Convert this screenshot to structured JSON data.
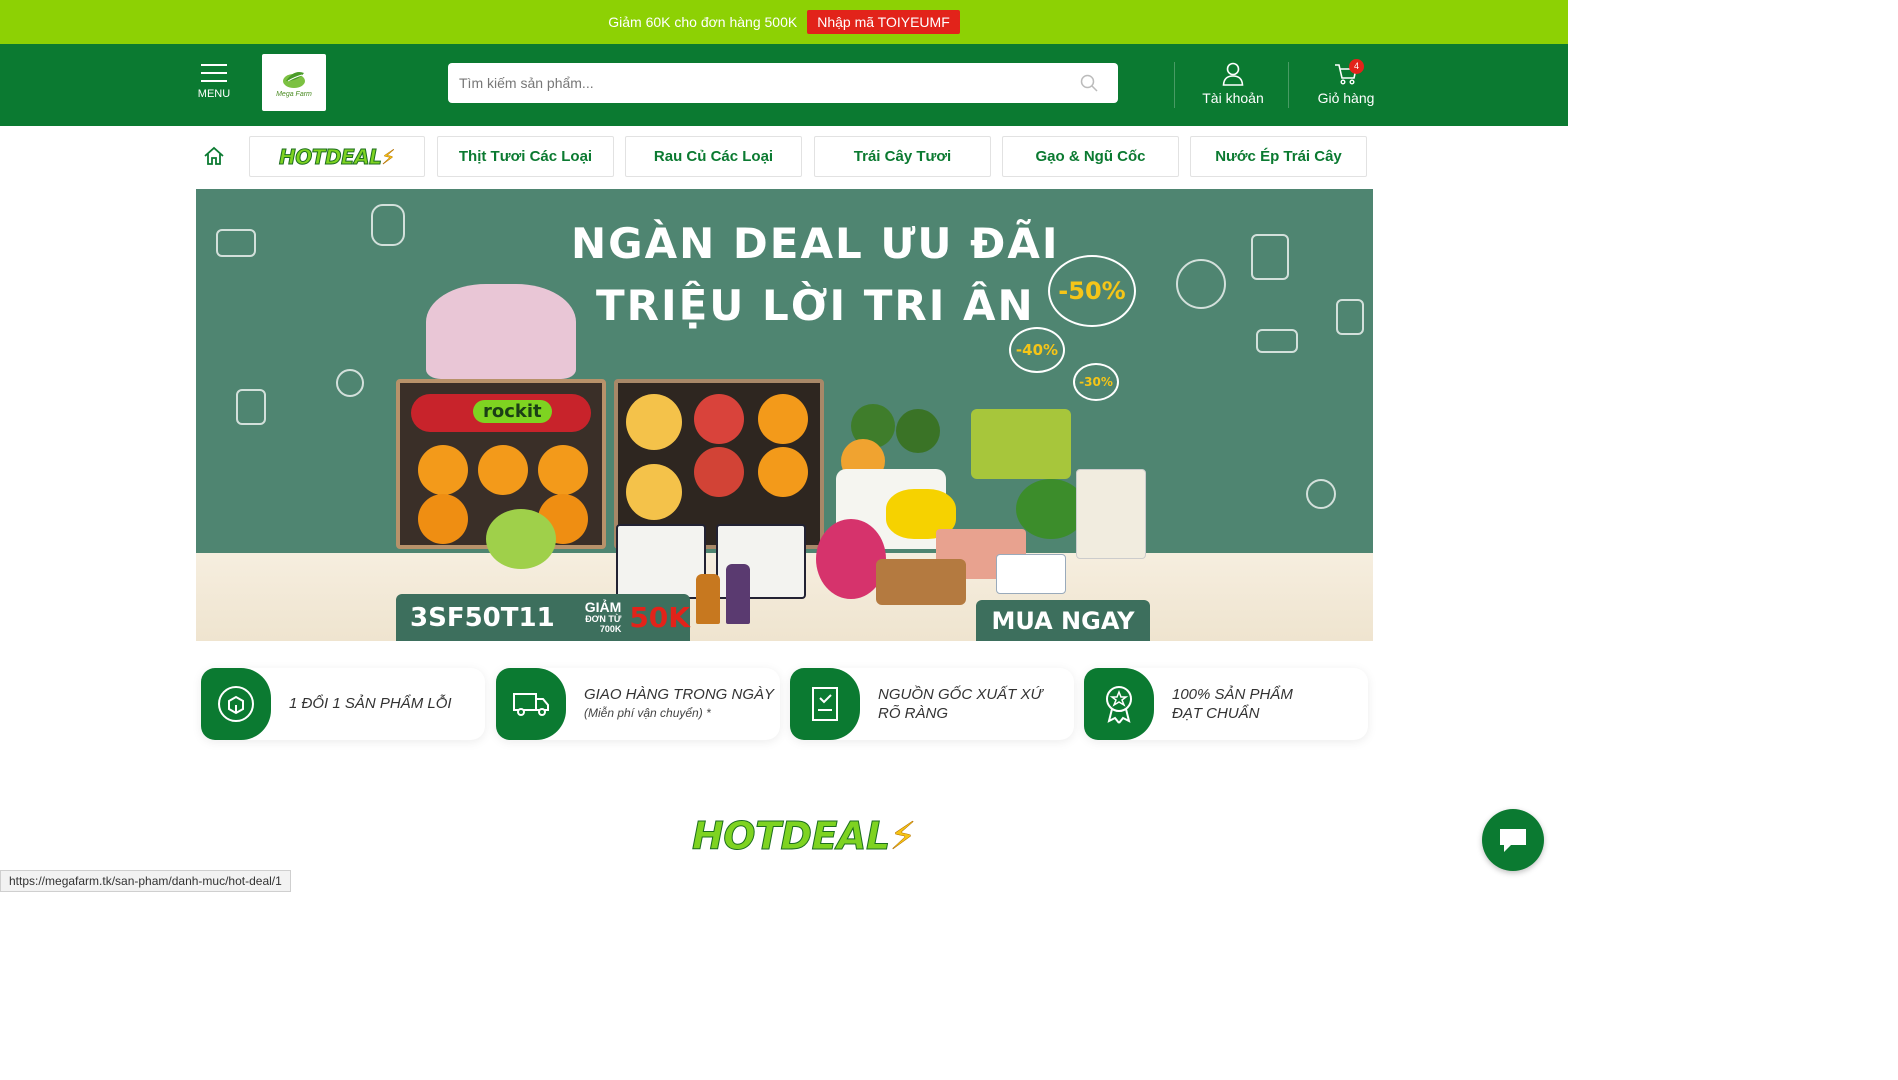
{
  "promo": {
    "text": "Giảm 60K cho đơn hàng 500K",
    "code": "Nhập mã TOIYEUMF"
  },
  "header": {
    "menu_label": "MENU",
    "logo_text": "Mega Farm",
    "search_placeholder": "Tìm kiếm sản phẩm...",
    "account_label": "Tài khoản",
    "cart_label": "Giỏ hàng",
    "cart_count": "4"
  },
  "nav": {
    "hotdeal": "HOTDEAL",
    "items": [
      "Thịt Tươi Các Loại",
      "Rau Củ Các Loại",
      "Trái Cây Tươi",
      "Gạo & Ngũ Cốc",
      "Nước Ép Trái Cây"
    ]
  },
  "banner": {
    "headline1": "NGÀN DEAL ƯU ĐÃI",
    "headline2": "TRIỆU LỜI TRI ÂN",
    "discount1": "-50%",
    "discount2": "-40%",
    "discount3": "-30%",
    "code": "3SF50T11",
    "code_giam": "GIẢM",
    "code_note": "ĐƠN TỪ 700K",
    "code_value": "50K",
    "box_brand": "rockit",
    "buy_label": "MUA NGAY"
  },
  "features": [
    {
      "title": "1 ĐỔI 1 SẢN PHẨM LỖI",
      "subtitle": "",
      "icon": "return-box-icon"
    },
    {
      "title": "GIAO HÀNG TRONG NGÀY",
      "subtitle": "(Miễn phí vận chuyển) *",
      "icon": "delivery-truck-icon"
    },
    {
      "title": "NGUỒN GỐC XUẤT XỨ",
      "subtitle_line": "RÕ RÀNG",
      "icon": "certificate-icon"
    },
    {
      "title": "100% SẢN PHẨM",
      "subtitle_line": "ĐẠT CHUẨN",
      "icon": "award-medal-icon"
    }
  ],
  "section": {
    "hotdeal_title": "HOTDEAL"
  },
  "status_url": "https://megafarm.tk/san-pham/danh-muc/hot-deal/1",
  "colors": {
    "promo_green": "#8dd104",
    "header_green": "#0b7a31",
    "accent_red": "#e2231a",
    "banner_green": "#4f8571"
  }
}
